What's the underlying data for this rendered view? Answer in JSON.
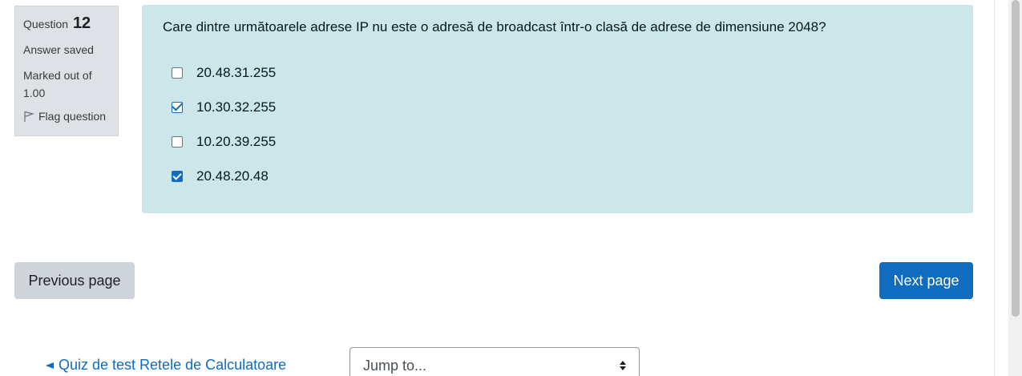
{
  "info": {
    "question_label": "Question",
    "question_number": "12",
    "state": "Answer saved",
    "grade": "Marked out of 1.00",
    "flag_label": "Flag question"
  },
  "question": {
    "text": "Care dintre următoarele adrese IP nu este o adresă de broadcast într-o clasă de adrese de dimensiune 2048?",
    "options": [
      {
        "label": "20.48.31.255",
        "checked": false
      },
      {
        "label": "10.30.32.255",
        "checked": true
      },
      {
        "label": "10.20.39.255",
        "checked": false
      },
      {
        "label": "20.48.20.48",
        "checked": true
      }
    ]
  },
  "nav": {
    "prev_label": "Previous page",
    "next_label": "Next page"
  },
  "footer": {
    "back_link": "Quiz de test Retele de Calculatoare",
    "jump_placeholder": "Jump to..."
  },
  "colors": {
    "accent": "#0f6cbf",
    "content_bg": "#cce6ea",
    "info_bg": "#dee2e6"
  },
  "icons": [
    "flag-icon",
    "checkbox-icon",
    "left-triangle-icon",
    "select-arrows-icon"
  ]
}
